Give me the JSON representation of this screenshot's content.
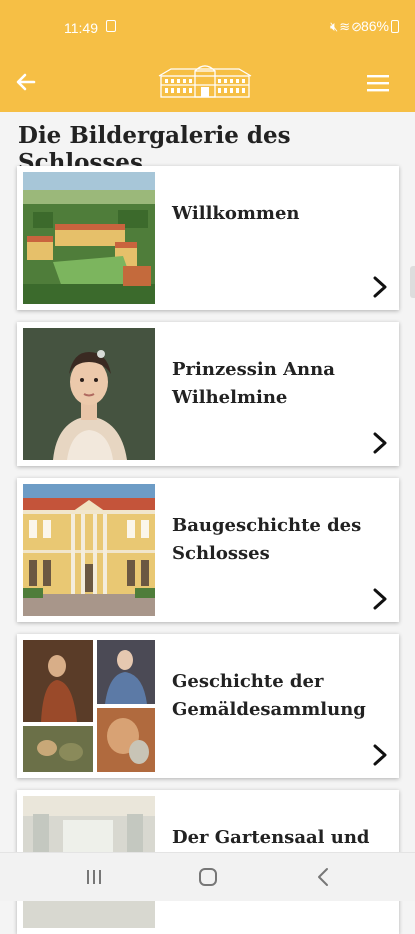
{
  "status_bar": {
    "time": "11:49",
    "battery": "86%",
    "icons": [
      "notification-icon",
      "mute-icon",
      "wifi-icon",
      "do-not-disturb-icon",
      "battery-icon"
    ]
  },
  "app_bar": {
    "back_icon": "arrow-left-icon",
    "logo": "palace-logo",
    "menu_icon": "hamburger-menu-icon",
    "background_color": "#f6bf45"
  },
  "page": {
    "title": "Die Bildergalerie des Schlosses"
  },
  "gallery_items": [
    {
      "label": "Willkommen",
      "image": "aerial-palace-photo"
    },
    {
      "label": "Prinzessin Anna Wilhelmine",
      "image": "princess-portrait-painting"
    },
    {
      "label": "Baugeschichte des Schlosses",
      "image": "palace-facade-photo"
    },
    {
      "label": "Geschichte der Gemäldesammlung",
      "image": "painting-collage"
    },
    {
      "label": "Der Gartensaal und",
      "image": "garden-hall-photo"
    }
  ],
  "nav_bar": {
    "buttons": [
      "recent-apps-icon",
      "home-icon",
      "back-icon"
    ]
  }
}
